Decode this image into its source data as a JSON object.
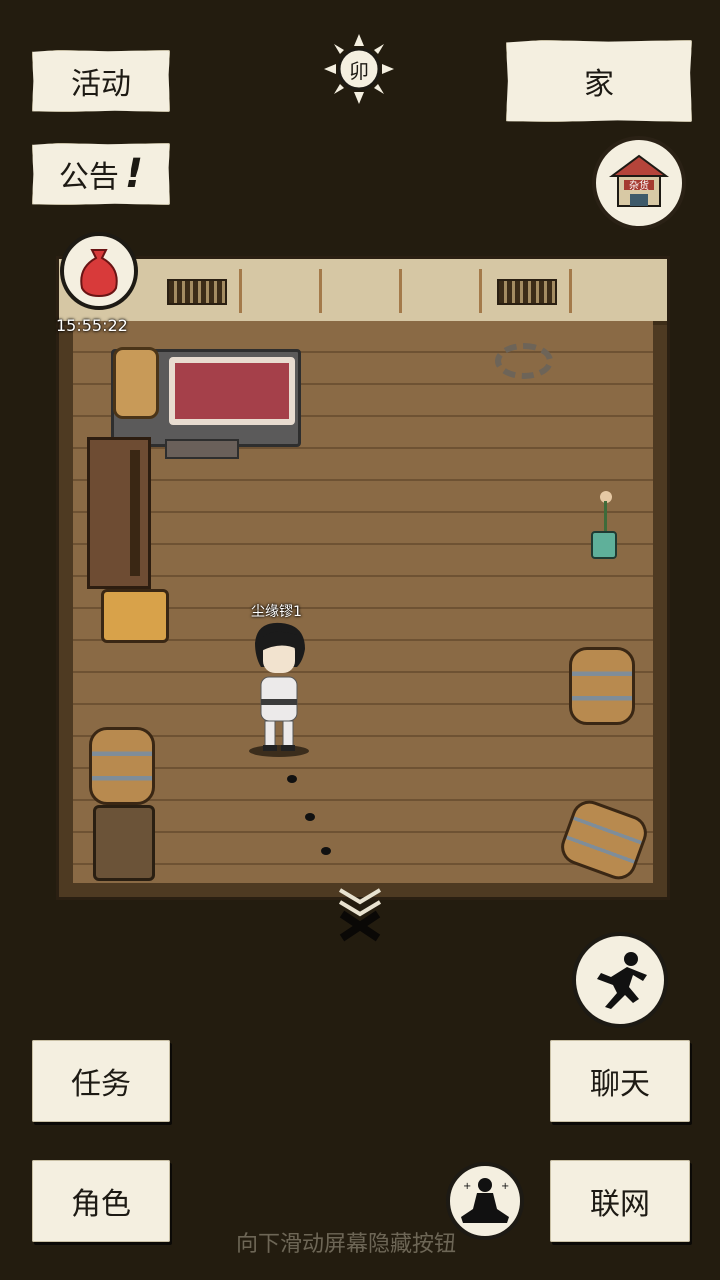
{
  "top_left_buttons": {
    "activity": "活动",
    "notice": "公告",
    "notice_alert": "!"
  },
  "time_icon": "卯",
  "home_button": "家",
  "shop_icon_text": "杂货",
  "gift_timer": "15:55:22",
  "player_name": "尘缘镠1",
  "bottom_buttons": {
    "quest": "任务",
    "character": "角色",
    "chat": "聊天",
    "network": "联网"
  },
  "hint_text": "向下滑动屏幕隐藏按钮",
  "icons": {
    "sun": "sun-icon",
    "shop": "shop-icon",
    "gift": "gift-bag-icon",
    "collapse": "chevron-down-icon",
    "run": "run-icon",
    "meditate": "meditate-icon"
  },
  "colors": {
    "background": "#231c0f",
    "button_bg": "#f4efe0",
    "floor": "#8a6a45"
  }
}
